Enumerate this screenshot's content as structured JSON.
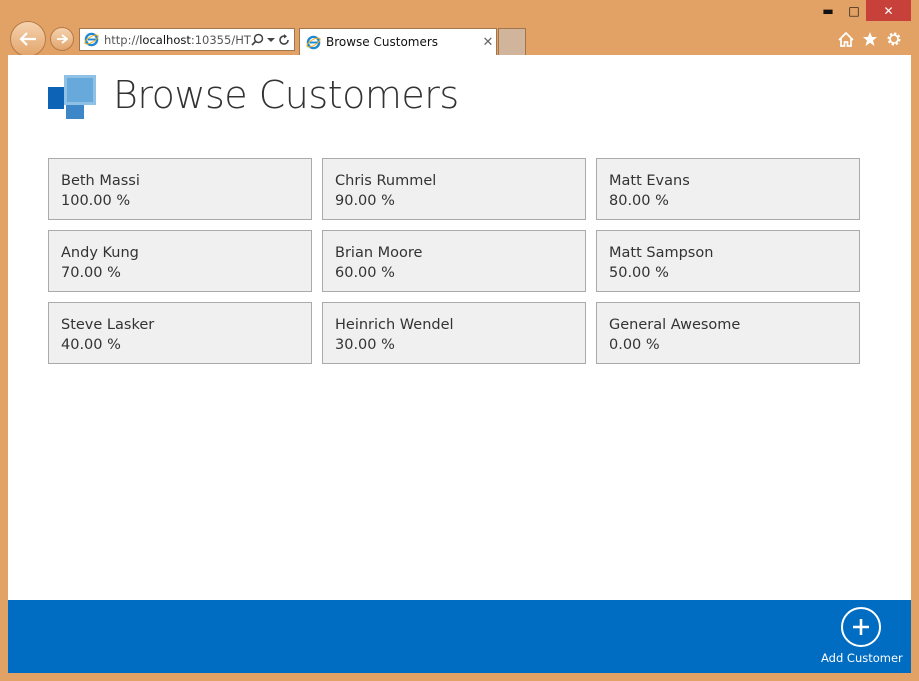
{
  "browser": {
    "address_prefix": "http://",
    "address_host": "localhost",
    "address_rest": ":10355/HT",
    "tab_title": "Browse Customers",
    "icons": [
      "back-arrow-icon",
      "forward-arrow-icon",
      "ie-icon",
      "search-icon",
      "dropdown-icon",
      "refresh-icon",
      "close-icon",
      "home-icon",
      "star-icon",
      "gear-icon"
    ]
  },
  "page": {
    "title": "Browse Customers"
  },
  "customers": [
    {
      "name": "Beth Massi",
      "percent": "100.00 %"
    },
    {
      "name": "Chris Rummel",
      "percent": "90.00 %"
    },
    {
      "name": "Matt Evans",
      "percent": "80.00 %"
    },
    {
      "name": "Andy Kung",
      "percent": "70.00 %"
    },
    {
      "name": "Brian Moore",
      "percent": "60.00 %"
    },
    {
      "name": "Matt Sampson",
      "percent": "50.00 %"
    },
    {
      "name": "Steve Lasker",
      "percent": "40.00 %"
    },
    {
      "name": "Heinrich Wendel",
      "percent": "30.00 %"
    },
    {
      "name": "General Awesome",
      "percent": "0.00 %"
    }
  ],
  "command_bar": {
    "add_label": "Add Customer",
    "add_icon": "plus-circle-icon"
  },
  "colors": {
    "chrome": "#e3a265",
    "command_bar": "#006dc2",
    "tile_bg": "#f0f0f0",
    "close_button": "#c7403a"
  }
}
